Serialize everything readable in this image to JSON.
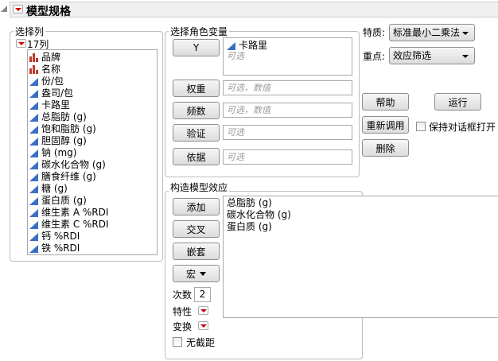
{
  "header": {
    "title": "模型规格"
  },
  "columns": {
    "group_label": "选择列",
    "count_label": "17列",
    "items": [
      {
        "label": "品牌",
        "type": "nominal"
      },
      {
        "label": "名称",
        "type": "nominal"
      },
      {
        "label": "份/包",
        "type": "continuous"
      },
      {
        "label": "盎司/包",
        "type": "continuous"
      },
      {
        "label": "卡路里",
        "type": "continuous"
      },
      {
        "label": "总脂肪 (g)",
        "type": "continuous"
      },
      {
        "label": "饱和脂肪 (g)",
        "type": "continuous"
      },
      {
        "label": "胆固醇 (g)",
        "type": "continuous"
      },
      {
        "label": "钠 (mg)",
        "type": "continuous"
      },
      {
        "label": "碳水化合物 (g)",
        "type": "continuous"
      },
      {
        "label": "膳食纤维 (g)",
        "type": "continuous"
      },
      {
        "label": "糖 (g)",
        "type": "continuous"
      },
      {
        "label": "蛋白质 (g)",
        "type": "continuous"
      },
      {
        "label": "维生素 A %RDI",
        "type": "continuous"
      },
      {
        "label": "维生素 C %RDI",
        "type": "continuous"
      },
      {
        "label": "钙 %RDI",
        "type": "continuous"
      },
      {
        "label": "铁 %RDI",
        "type": "continuous"
      }
    ]
  },
  "roles": {
    "group_label": "选择角色变量",
    "y": {
      "button": "Y",
      "value": "卡路里",
      "placeholder": "可选"
    },
    "weight": {
      "button": "权重",
      "placeholder": "可选，数值"
    },
    "freq": {
      "button": "频数",
      "placeholder": "可选，数值"
    },
    "validation": {
      "button": "验证",
      "placeholder": "可选"
    },
    "by": {
      "button": "依据",
      "placeholder": "可选"
    }
  },
  "options": {
    "personality_label": "特质:",
    "personality_value": "标准最小二乘法",
    "emphasis_label": "重点:",
    "emphasis_value": "效应筛选"
  },
  "actions": {
    "help": "帮助",
    "run": "运行",
    "recall": "重新调用",
    "remove": "删除",
    "keep_open": "保持对话框打开"
  },
  "effects": {
    "group_label": "构造模型效应",
    "add": "添加",
    "cross": "交叉",
    "nest": "嵌套",
    "macros": "宏",
    "degree_label": "次数",
    "degree_value": "2",
    "attributes_label": "特性",
    "transform_label": "变换",
    "no_intercept": "无截距",
    "items": [
      "总脂肪 (g)",
      "碳水化合物 (g)",
      "蛋白质 (g)"
    ]
  }
}
